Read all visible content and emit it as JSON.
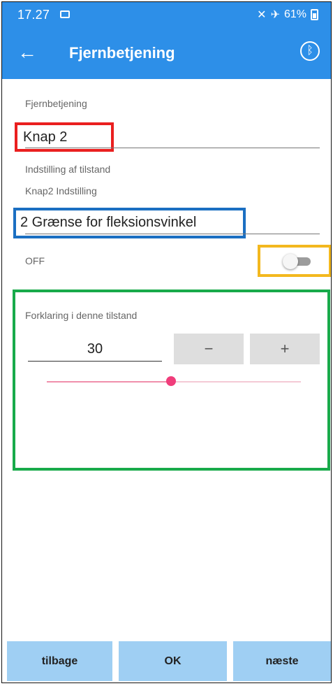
{
  "status_bar": {
    "time": "17.27",
    "battery": "61%"
  },
  "app_bar": {
    "title": "Fjernbetjening",
    "back_icon": "arrow-left-icon",
    "bluetooth_icon": "bluetooth-icon"
  },
  "form": {
    "remote_label": "Fjernbetjening",
    "remote_value": "Knap 2",
    "state_setting_label": "Indstilling af tilstand",
    "button_setting_label": "Knap2 Indstilling",
    "mode_value": "2 Grænse for fleksionsvinkel",
    "toggle_label": "OFF",
    "toggle_on": false
  },
  "explanation": {
    "label": "Forklaring i denne tilstand",
    "value": "30",
    "minus_label": "−",
    "plus_label": "+",
    "slider_fraction": 0.49
  },
  "bottom_nav": {
    "back_label": "tilbage",
    "ok_label": "OK",
    "next_label": "næste"
  },
  "colors": {
    "primary": "#2d8fe8",
    "highlight_red": "#ea1f1f",
    "highlight_blue": "#1b6fc2",
    "highlight_yellow": "#f3b81e",
    "highlight_green": "#18aa4a",
    "slider_accent": "#f03d7b",
    "nav_button": "#9fcff3"
  }
}
